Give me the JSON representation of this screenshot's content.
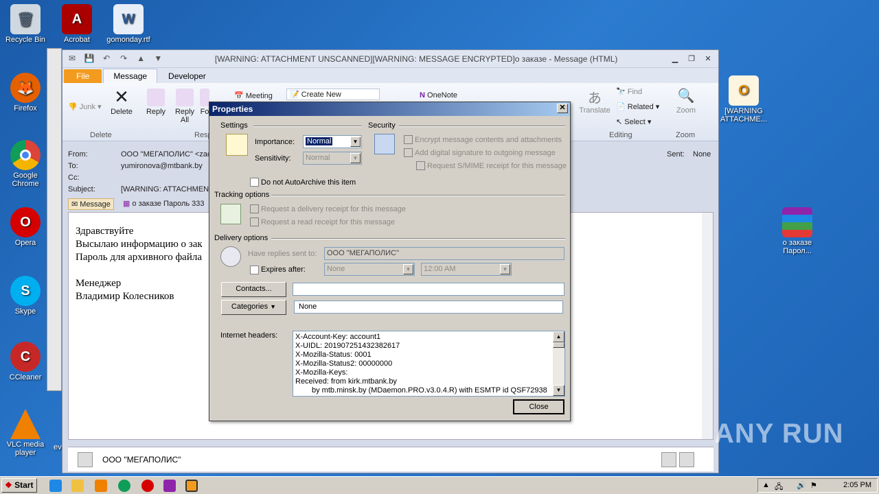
{
  "desktop": {
    "icons": [
      {
        "label": "Recycle Bin",
        "icon": "recycle-bin-icon"
      },
      {
        "label": "Acrobat",
        "icon": "acrobat-icon"
      },
      {
        "label": "gomonday.rtf",
        "icon": "word-document-icon"
      },
      {
        "label": "Firefox",
        "icon": "firefox-icon"
      },
      {
        "label": "Google Chrome",
        "icon": "chrome-icon"
      },
      {
        "label": "Opera",
        "icon": "opera-icon"
      },
      {
        "label": "Skype",
        "icon": "skype-icon"
      },
      {
        "label": "CCleaner",
        "icon": "ccleaner-icon"
      },
      {
        "label": "VLC media player",
        "icon": "vlc-icon"
      },
      {
        "label": "[WARNING ATTACHME...",
        "icon": "outlook-message-icon"
      },
      {
        "label": "о заказе Парол...",
        "icon": "winrar-archive-icon"
      }
    ],
    "partial_label_ev": "ev"
  },
  "outlook": {
    "title": "[WARNING: ATTACHMENT UNSCANNED][WARNING: MESSAGE ENCRYPTED]о заказе  -  Message (HTML)",
    "tabs": [
      "File",
      "Message",
      "Developer"
    ],
    "ribbon": {
      "junk": "Junk",
      "delete": "Delete",
      "reply": "Reply",
      "reply_all": "Reply All",
      "forward_partial": "Fo",
      "meeting": "Meeting",
      "create_new": "Create New",
      "onenote": "OneNote",
      "translate": "Translate",
      "find": "Find",
      "related": "Related",
      "select": "Select",
      "zoom": "Zoom",
      "group_delete": "Delete",
      "group_respond_partial": "Resp",
      "group_editing": "Editing",
      "group_zoom": "Zoom"
    },
    "header": {
      "from_label": "From:",
      "from_value": "ООО \"МЕГАПОЛИС\" <zacc",
      "to_label": "To:",
      "to_value": "yumironova@mtbank.by",
      "cc_label": "Cc:",
      "subject_label": "Subject:",
      "subject_value": "[WARNING: ATTACHMENT",
      "sent_label": "Sent:",
      "sent_value": "None",
      "message_tab": "Message",
      "attachment": "о заказе Пароль 333"
    },
    "body_lines": [
      "Здравствуйте",
      "Высылаю информацию о зак",
      "Пароль для архивного файла",
      "",
      "Менеджер",
      "Владимир Колесников"
    ],
    "people_pane_name": "ООО \"МЕГАПОЛИС\""
  },
  "dialog": {
    "title": "Properties",
    "close_x": "✕",
    "settings_label": "Settings",
    "security_label": "Security",
    "importance_label": "Importance:",
    "importance_value": "Normal",
    "sensitivity_label": "Sensitivity:",
    "sensitivity_value": "Normal",
    "encrypt_label": "Encrypt message contents and attachments",
    "signature_label": "Add digital signature to outgoing message",
    "smime_label": "Request S/MIME receipt for this message",
    "autoarchive_label": "Do not AutoArchive this item",
    "tracking_label": "Tracking options",
    "delivery_receipt_label": "Request a delivery receipt for this message",
    "read_receipt_label": "Request a read receipt for this message",
    "delivery_label": "Delivery options",
    "replies_label": "Have replies sent to:",
    "replies_value": "ООО \"МЕГАПОЛИС\"",
    "expires_label": "Expires after:",
    "expires_date": "None",
    "expires_time": "12:00 AM",
    "contacts_button": "Contacts...",
    "contacts_value": "",
    "categories_button": "Categories",
    "categories_value": "None",
    "internet_headers_label": "Internet headers:",
    "headers": [
      "X-Account-Key: account1",
      "X-UIDL: 201907251432382617",
      "X-Mozilla-Status: 0001",
      "X-Mozilla-Status2: 00000000",
      "X-Mozilla-Keys:",
      "Received: from kirk.mtbank.by",
      "by mtb.minsk.by (MDaemon.PRO.v3.0.4.R) with ESMTP id QSF72938"
    ],
    "close_button": "Close"
  },
  "taskbar": {
    "start": "Start",
    "clock": "2:05 PM"
  },
  "watermark": "ANY RUN"
}
